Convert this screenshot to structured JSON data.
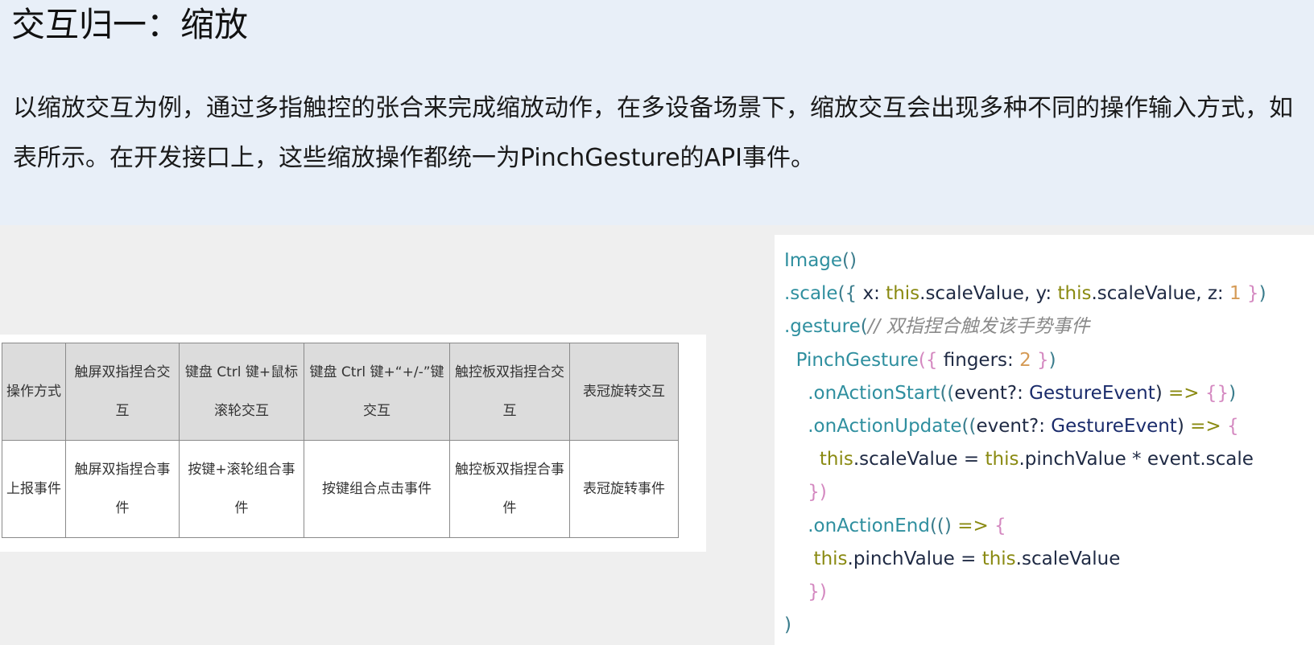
{
  "title": "交互归一：缩放",
  "intro": "以缩放交互为例，通过多指触控的张合来完成缩放动作，在多设备场景下，缩放交互会出现多种不同的操作输入方式，如表所示。在开发接口上，这些缩放操作都统一为PinchGesture的API事件。",
  "table": {
    "header": [
      "操作方式",
      "触屏双指捏合交互",
      "键盘 Ctrl 键+鼠标滚轮交互",
      "键盘 Ctrl 键+“+/-”键交互",
      "触控板双指捏合交互",
      "表冠旋转交互"
    ],
    "row": [
      "上报事件",
      "触屏双指捏合事件",
      "按键+滚轮组合事件",
      "按键组合点击事件",
      "触控板双指捏合事件",
      "表冠旋转事件"
    ]
  },
  "code": {
    "l1_fn": "Image",
    "l1_p": "()",
    "l2_fn": ".scale",
    "l2_a": "({",
    "l2_b": " x: ",
    "l2_this1": "this",
    "l2_c": ".scaleValue, y: ",
    "l2_this2": "this",
    "l2_d": ".scaleValue, z: ",
    "l2_num": "1",
    "l2_e": " }",
    "l2_f": ")",
    "l3_fn": ".gesture",
    "l3_p": "(",
    "l3_cm": "// 双指捏合触发该手势事件",
    "l4_fn": "  PinchGesture",
    "l4_a": "({",
    "l4_b": " fingers: ",
    "l4_num": "2",
    "l4_c": " }",
    "l4_d": ")",
    "l5_fn": "    .onActionStart",
    "l5_a": "((",
    "l5_b": "event?: ",
    "l5_ty": "GestureEvent",
    "l5_c": ") ",
    "l5_arrow": "=>",
    "l5_d": " {}",
    "l5_e": ")",
    "l6_fn": "    .onActionUpdate",
    "l6_a": "((",
    "l6_b": "event?: ",
    "l6_ty": "GestureEvent",
    "l6_c": ") ",
    "l6_arrow": "=>",
    "l6_d": " {",
    "l7_this1": "      this",
    "l7_a": ".scaleValue = ",
    "l7_this2": "this",
    "l7_b": ".pinchValue * event.scale",
    "l8_a": "    })",
    "l9_fn": "    .onActionEnd",
    "l9_a": "(() ",
    "l9_arrow": "=>",
    "l9_b": " {",
    "l10_this1": "     this",
    "l10_a": ".pinchValue = ",
    "l10_this2": "this",
    "l10_b": ".scaleValue",
    "l11_a": "    })",
    "l12_a": ")"
  }
}
